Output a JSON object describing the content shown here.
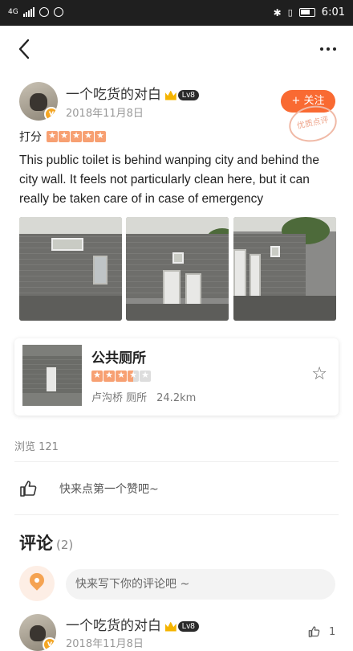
{
  "status": {
    "network": "4G",
    "time": "6:01"
  },
  "post": {
    "author": "一个吃货的对白",
    "level": "Lv8",
    "date": "2018年11月8日",
    "follow_label": "+ 关注",
    "stamp_text": "优质点评",
    "rating_label": "打分",
    "rating_stars": 5,
    "text": "This public toilet is behind wanping city and behind the city wall. It feels not particularly clean here, but it can really be taken care of in case of emergency"
  },
  "place": {
    "name": "公共厕所",
    "rating": 3.5,
    "area": "卢沟桥 厕所",
    "distance": "24.2km"
  },
  "views": "浏览 121",
  "like_prompt": "快来点第一个赞吧~",
  "comments": {
    "title": "评论",
    "count": "(2)",
    "placeholder": "快来写下你的评论吧 ~"
  },
  "first_comment": {
    "author": "一个吃货的对白",
    "level": "Lv8",
    "date": "2018年11月8日",
    "likes": "1"
  },
  "colors": {
    "accent": "#f96a32",
    "star": "#f7a072"
  }
}
